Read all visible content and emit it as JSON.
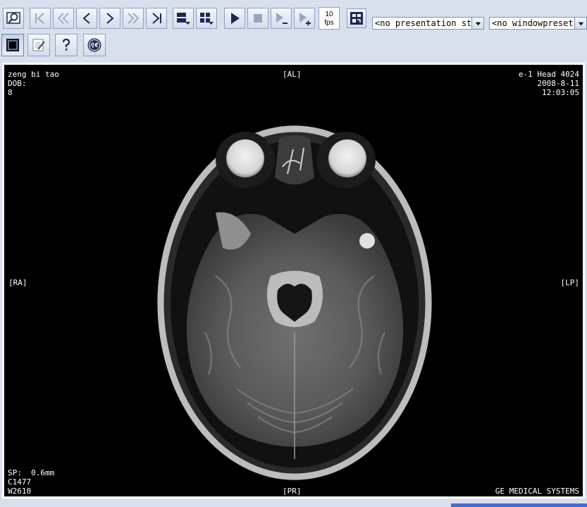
{
  "toolbar": {
    "buttons": [
      {
        "name": "zoom-view-button",
        "icon": "magnifier-icon"
      },
      {
        "name": "first-image-button",
        "icon": "skip-first-icon"
      },
      {
        "name": "fast-rewind-button",
        "icon": "double-chevron-left-icon"
      },
      {
        "name": "previous-image-button",
        "icon": "chevron-left-icon"
      },
      {
        "name": "next-image-button",
        "icon": "chevron-right-icon"
      },
      {
        "name": "fast-forward-button",
        "icon": "double-chevron-right-icon"
      },
      {
        "name": "last-image-button",
        "icon": "skip-last-icon"
      },
      {
        "name": "layout-rows-button",
        "icon": "layout-rows-icon"
      },
      {
        "name": "layout-grid-button",
        "icon": "layout-grid-icon"
      },
      {
        "name": "play-button",
        "icon": "play-icon"
      },
      {
        "name": "stop-button",
        "icon": "stop-icon"
      },
      {
        "name": "slower-button",
        "icon": "play-minus-icon"
      },
      {
        "name": "faster-button",
        "icon": "play-plus-icon"
      },
      {
        "name": "cine-settings-button",
        "icon": "film-strip-icon"
      }
    ],
    "fps_value": "10",
    "fps_unit": "fps",
    "presentation_select": "<no presentation st",
    "windowpreset_select": "<no windowpreset>",
    "row2": [
      {
        "name": "fullscreen-button",
        "icon": "screen-icon"
      },
      {
        "name": "annotate-button",
        "icon": "notepad-pencil-icon"
      },
      {
        "name": "help-button",
        "icon": "question-icon"
      },
      {
        "name": "ge-logo-button",
        "icon": "ge-logo-icon"
      }
    ]
  },
  "viewer": {
    "patient_name": "zeng bi tao",
    "dob_label": "DOB:",
    "age": "8",
    "top_center": "[AL]",
    "series": "e-1 Head 4024",
    "date": "2008-8-11",
    "time": "12:03:05",
    "left_mid": "[RA]",
    "right_mid": "[LP]",
    "spacing": "SP:  0.6mm",
    "window_center": "C1477",
    "window_width": "W2610",
    "bottom_center": "[PR]",
    "manufacturer": "GE MEDICAL SYSTEMS"
  },
  "colors": {
    "toolbar_bg": "#d8e0ee",
    "viewer_bg": "#000000",
    "overlay_text": "#ffffff",
    "button_glyph": "#1a2a52"
  }
}
